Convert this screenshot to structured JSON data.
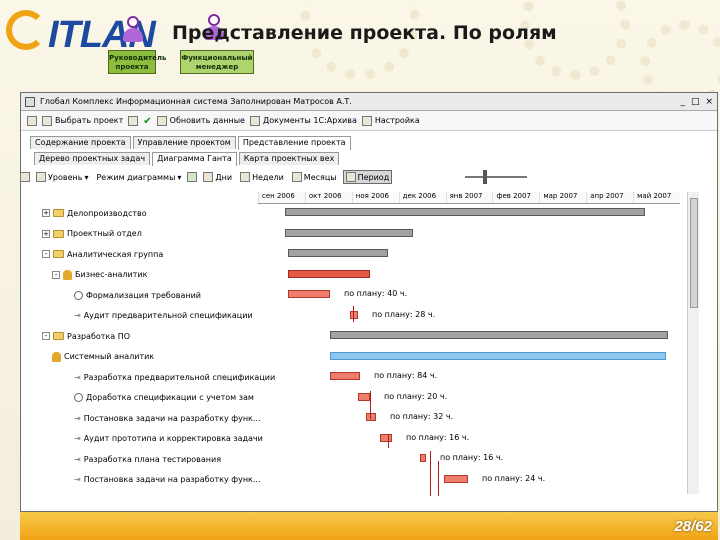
{
  "slide": {
    "logo_text": "ITLAN",
    "title": "Представление проекта. По ролям",
    "page_number": "28/62",
    "roles": [
      {
        "label": "Руководитель проекта"
      },
      {
        "label": "Функциональный менеджер"
      }
    ]
  },
  "window": {
    "title": "Глобал Комплекс  Информационная система  Заполнирован  Матросов А.Т.",
    "controls": [
      "_",
      "□",
      "×"
    ],
    "toolbar": [
      {
        "label": "Выбрать проект"
      },
      {
        "label": "Обновить данные"
      },
      {
        "label": "Документы 1С:Архива"
      },
      {
        "label": "Настройка"
      }
    ],
    "main_tabs": [
      {
        "label": "Содержание проекта"
      },
      {
        "label": "Управление проектом"
      },
      {
        "label": "Представление проекта",
        "active": true
      }
    ],
    "sub_tabs": [
      {
        "label": "Дерево проектных задач"
      },
      {
        "label": "Диаграмма Ганта",
        "active": true
      },
      {
        "label": "Карта проектных вех"
      }
    ],
    "gantt_toolbar": {
      "level_label": "Уровень",
      "mode_label": "Режим диаграммы",
      "scales": [
        {
          "label": "Дни"
        },
        {
          "label": "Недели"
        },
        {
          "label": "Месяцы"
        },
        {
          "label": "Период",
          "active": true
        }
      ]
    },
    "months": [
      "сен 2006",
      "окт 2006",
      "ноя 2006",
      "дек 2006",
      "янв 2007",
      "фев 2007",
      "мар 2007",
      "апр 2007",
      "май 2007"
    ],
    "rows": [
      {
        "label": "Делопроизводство",
        "icon": "folder",
        "expander": "+",
        "level": 0
      },
      {
        "label": "Проектный отдел",
        "icon": "folder",
        "expander": "+",
        "level": 0
      },
      {
        "label": "Аналитическая группа",
        "icon": "folder",
        "expander": "-",
        "level": 0
      },
      {
        "label": "Бизнес-аналитик",
        "icon": "person",
        "expander": "-",
        "level": 1
      },
      {
        "label": "Формализация требований",
        "icon": "clock",
        "level": 2
      },
      {
        "label": "Аудит предварительной спецификации",
        "icon": "arrow",
        "level": 2
      },
      {
        "label": "Разработка ПО",
        "icon": "folder",
        "expander": "-",
        "level": 0
      },
      {
        "label": "Системный аналитик",
        "icon": "person",
        "level": 1
      },
      {
        "label": "Разработка предварительной спецификации",
        "icon": "arrow",
        "level": 2
      },
      {
        "label": "Доработка спецификации с учетом зам",
        "icon": "clock",
        "level": 2
      },
      {
        "label": "Постановка задачи на разработку функ...",
        "icon": "arrow",
        "level": 2
      },
      {
        "label": "Аудит прототипа и корректировка задачи",
        "icon": "arrow",
        "level": 2
      },
      {
        "label": "Разработка плана тестирования",
        "icon": "arrow",
        "level": 2
      },
      {
        "label": "Постановка задачи на разработку функ...",
        "icon": "arrow",
        "level": 2
      }
    ],
    "bar_labels": [
      "по плану: 40 ч.",
      "по плану: 28 ч.",
      "по плану: 84 ч.",
      "по плану: 20 ч.",
      "по плану: 32 ч.",
      "по плану: 16 ч.",
      "по плану: 16 ч.",
      "по плану: 24 ч."
    ]
  },
  "colors": {
    "summary_bar": "#a2a2a2",
    "task_bar": "#ef7d6c",
    "role_bar": "#e35a45",
    "highlight_bar": "#8fc7ee",
    "footer": "#f0a315"
  }
}
